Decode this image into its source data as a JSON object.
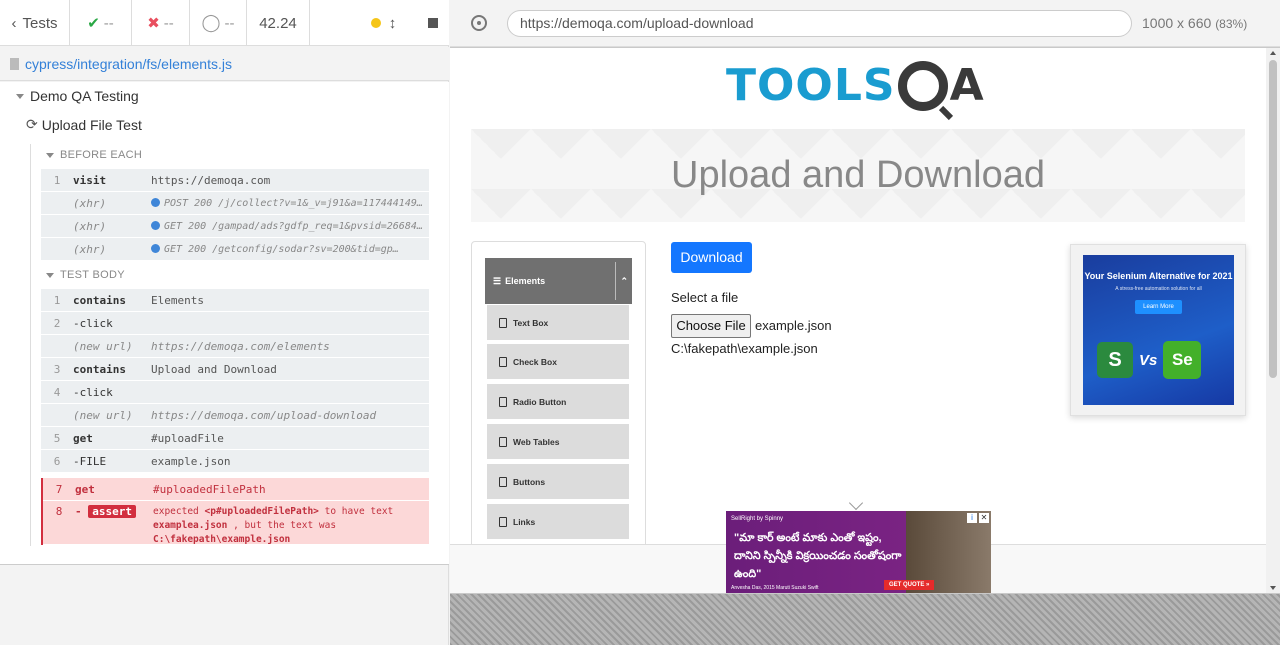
{
  "runner": {
    "tests_label": "Tests",
    "passed": "--",
    "failed": "--",
    "pending": "--",
    "duration": "42.24",
    "spec_path": "cypress/integration/fs/elements.js",
    "suite_title": "Demo QA Testing",
    "test_title": "Upload File Test",
    "before_each_label": "BEFORE EACH",
    "test_body_label": "TEST BODY",
    "before_each": [
      {
        "num": "1",
        "name": "visit",
        "msg": "https://demoqa.com"
      },
      {
        "num": "",
        "name": "(xhr)",
        "msg": "POST 200 /j/collect?v=1&_v=j91&a=117444149&t=…"
      },
      {
        "num": "",
        "name": "(xhr)",
        "msg": "GET 200 /gampad/ads?gdfp_req=1&pvsid=26684040…"
      },
      {
        "num": "",
        "name": "(xhr)",
        "msg": "GET 200 /getconfig/sodar?sv=200&tid=gp…"
      }
    ],
    "test_body": [
      {
        "num": "1",
        "name": "contains",
        "msg": "Elements"
      },
      {
        "num": "2",
        "name": "-click",
        "msg": ""
      },
      {
        "num": "",
        "name": "(new url)",
        "msg": "https://demoqa.com/elements"
      },
      {
        "num": "3",
        "name": "contains",
        "msg": "Upload and Download"
      },
      {
        "num": "4",
        "name": "-click",
        "msg": ""
      },
      {
        "num": "",
        "name": "(new url)",
        "msg": "https://demoqa.com/upload-download"
      },
      {
        "num": "5",
        "name": "get",
        "msg": "#uploadFile"
      },
      {
        "num": "6",
        "name": "-FILE",
        "msg": "example.json"
      }
    ],
    "error_cmd": {
      "num": "7",
      "name": "get",
      "msg": "#uploadedFilePath"
    },
    "assert": {
      "num": "8",
      "label": "assert",
      "text1": "expected",
      "selector": "<p#uploadedFilePath>",
      "text2": "to have text",
      "expected": "examplea.json",
      "text3": ", but the text was",
      "actual": "C:\\fakepath\\example.json"
    }
  },
  "browser": {
    "url": "https://demoqa.com/upload-download",
    "viewport": "1000 x 660",
    "zoom": "(83%)"
  },
  "page": {
    "logo_left": "TOOLS",
    "logo_right": "A",
    "heading": "Upload and Download",
    "group_label": "Elements",
    "menu": [
      "Text Box",
      "Check Box",
      "Radio Button",
      "Web Tables",
      "Buttons",
      "Links"
    ],
    "download_label": "Download",
    "select_label": "Select a file",
    "choose_label": "Choose File",
    "chosen_file": "example.json",
    "uploaded_path": "C:\\fakepath\\example.json"
  },
  "ads": {
    "right_title": "Your Selenium Alternative for 2021",
    "right_sub": "A stress-free automation solution for all",
    "right_cta": "Learn More",
    "right_vs": "Vs",
    "right_logo1": "S",
    "right_logo2": "Se",
    "bottom_brand": "SellRight by Spinny",
    "bottom_text": "\"మా కార్ అంటే మాకు ఎంతో ఇష్టం, దానిని స్పిన్నీకి విక్రయించడం సంతోషంగా ఉంది\"",
    "bottom_cite": "Anvesha Das, 2015 Maruti Suzuki Swift",
    "bottom_cta": "GET QUOTE »"
  },
  "colors": {
    "pass": "#2aa845",
    "fail": "#e94f5f",
    "link": "#3380d8",
    "brand_blue": "#1a9cd0",
    "button_blue": "#1477ff"
  }
}
